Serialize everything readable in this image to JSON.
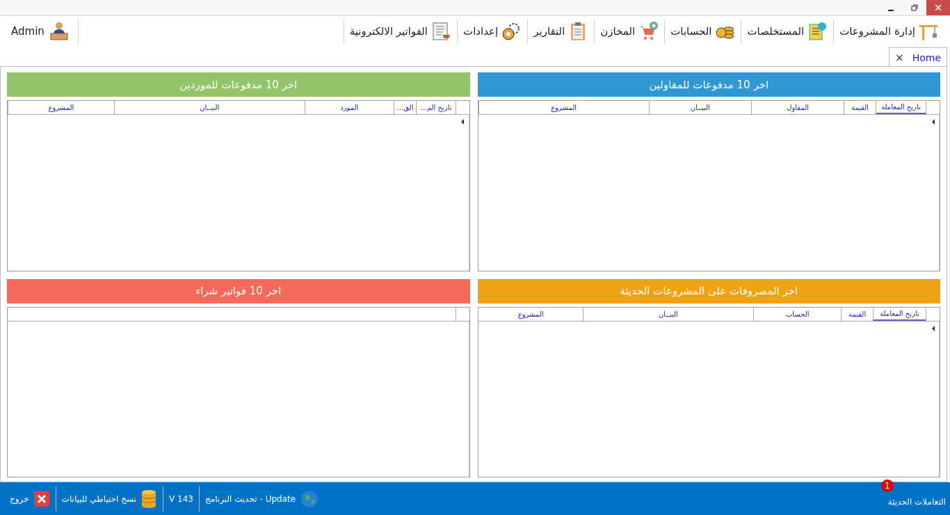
{
  "user": {
    "name": "Admin"
  },
  "menu": [
    {
      "label": "إدارة المشروعات"
    },
    {
      "label": "المستخلصات"
    },
    {
      "label": "الحسابات"
    },
    {
      "label": "المخازن"
    },
    {
      "label": "التقارير"
    },
    {
      "label": "إعدادات"
    },
    {
      "label": "الفواتير الالكترونية"
    }
  ],
  "tabs": [
    {
      "label": "Home",
      "selected": true,
      "close": "×"
    }
  ],
  "panels": [
    {
      "title": "اخر 10 مدفوعات للمقاولين",
      "color": "#2f97d3",
      "columns": [
        {
          "label": "تاريخ المعاملة",
          "selected": true
        },
        {
          "label": "القيمة",
          "selected": false
        },
        {
          "label": "المقاول",
          "selected": false
        },
        {
          "label": "البيــان",
          "selected": false
        },
        {
          "label": "المشروع",
          "selected": false
        }
      ]
    },
    {
      "title": "اخر 10 مدفوعات للموردين",
      "color": "#93c467",
      "columns": [
        {
          "label": "تاريخ الم...",
          "selected": false
        },
        {
          "label": "الق...",
          "selected": false
        },
        {
          "label": "المورد",
          "selected": false
        },
        {
          "label": "البيــان",
          "selected": false
        },
        {
          "label": "المشروع",
          "selected": false
        }
      ]
    },
    {
      "title": "اخر المصروفات على المشروعات الحديثة",
      "color": "#eea315",
      "columns": [
        {
          "label": "تاريخ المعاملة",
          "selected": true
        },
        {
          "label": "القيمة",
          "selected": false
        },
        {
          "label": "الحساب",
          "selected": false
        },
        {
          "label": "البيــان",
          "selected": false
        },
        {
          "label": "المشروع",
          "selected": false
        }
      ]
    },
    {
      "title": "اخر 10 فواتير شراء",
      "color": "#f5695b"
    }
  ],
  "status_bar": {
    "recent": {
      "label": "التعاملات الحديثة",
      "badge": "1"
    },
    "update": "Update - تحديث البرنامج",
    "version": "V 143",
    "backup": "نسخ احتياطي للبيانات",
    "exit": "خروج"
  }
}
